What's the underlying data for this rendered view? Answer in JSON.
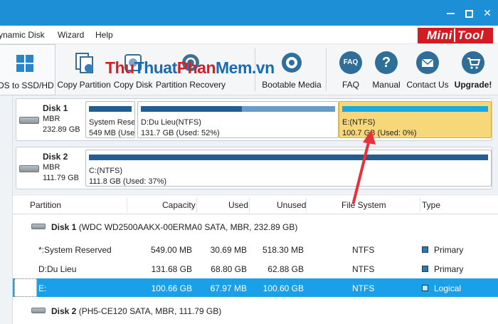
{
  "menu": [
    "ynamic Disk",
    "Wizard",
    "Help"
  ],
  "logo": {
    "part1": "Mini",
    "part2": "Tool"
  },
  "toolbar": {
    "buttons": [
      {
        "label": "OS to SSD/HD",
        "icon": "windows-migrate-icon"
      },
      {
        "label": "Copy Partition",
        "icon": "copy-partition-icon"
      },
      {
        "label": "Copy Disk",
        "icon": "copy-disk-icon"
      },
      {
        "label": "Partition Recovery",
        "icon": "partition-recovery-icon"
      },
      {
        "label": "Bootable Media",
        "icon": "bootable-media-icon"
      },
      {
        "label": "FAQ",
        "icon": "faq-icon"
      },
      {
        "label": "Manual",
        "icon": "manual-icon"
      },
      {
        "label": "Contact Us",
        "icon": "contact-us-icon"
      },
      {
        "label": "Upgrade!",
        "icon": "upgrade-cart-icon"
      }
    ],
    "faq_glyph": "FAQ",
    "manual_glyph": "?"
  },
  "watermark": {
    "part1": "Thu",
    "part2": "Thuat",
    "part3": "Phan",
    "part4": "Mem",
    "part5": ".vn"
  },
  "disks": [
    {
      "name": "Disk 1",
      "type": "MBR",
      "size": "232.89 GB",
      "partitions": [
        {
          "name": "System Rese",
          "info": "549 MB (Use",
          "used_ratio": 1.0
        },
        {
          "name": "D:Du Lieu(NTFS)",
          "info": "131.7 GB (Used: 52%)",
          "used_ratio": 0.52
        },
        {
          "name": "E:(NTFS)",
          "info": "100.7 GB (Used: 0%)",
          "used_ratio": 0.0,
          "selected": true
        }
      ]
    },
    {
      "name": "Disk 2",
      "type": "MBR",
      "size": "111.79 GB",
      "partitions": [
        {
          "name": "C:(NTFS)",
          "info": "111.8 GB (Used: 37%)",
          "used_ratio": 1.0
        }
      ]
    }
  ],
  "table": {
    "headers": [
      "Partition",
      "Capacity",
      "Used",
      "Unused",
      "File System",
      "Type"
    ],
    "disk1_header": {
      "name": "Disk 1",
      "detail": "(WDC WD2500AAKX-00ERMA0 SATA, MBR, 232.89 GB)"
    },
    "rows": [
      {
        "partition": "*:System Reserved",
        "capacity": "549.00 MB",
        "used": "30.69 MB",
        "unused": "518.30 MB",
        "fs": "NTFS",
        "type": "Primary"
      },
      {
        "partition": "D:Du Lieu",
        "capacity": "131.68 GB",
        "used": "68.80 GB",
        "unused": "62.88 GB",
        "fs": "NTFS",
        "type": "Primary"
      },
      {
        "partition": "E:",
        "capacity": "100.66 GB",
        "used": "67.97 MB",
        "unused": "100.60 GB",
        "fs": "NTFS",
        "type": "Logical",
        "selected": true
      }
    ],
    "disk2_header": {
      "name": "Disk 2",
      "detail": "(PH5-CE120 SATA, MBR, 111.79 GB)"
    }
  },
  "colors": {
    "titlebar": "#1c8fd6",
    "selected_row": "#1aa0e8",
    "selected_partition": "#f6d87b",
    "arrow": "#e8313a",
    "logo": "#d11c24"
  }
}
